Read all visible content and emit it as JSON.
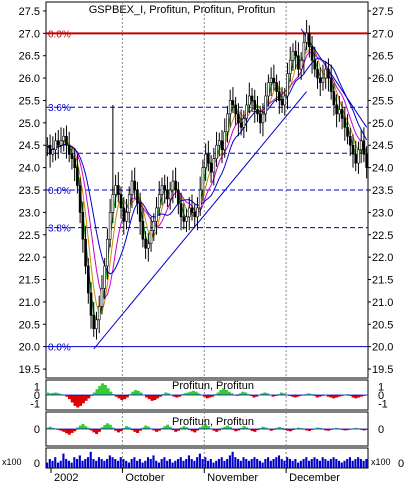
{
  "chart_data": [
    {
      "type": "candlestick",
      "title": "GSPBEX_I, Profitun, Profitun, Profitun",
      "y_ticks": [
        "27.5",
        "27.0",
        "26.5",
        "26.0",
        "25.5",
        "25.0",
        "24.5",
        "24.0",
        "23.5",
        "23.0",
        "22.5",
        "22.0",
        "21.5",
        "21.0",
        "20.5",
        "20.0",
        "19.5"
      ],
      "ylim": [
        19.3,
        27.7
      ],
      "x_ticks": [
        "2002",
        "October",
        "November",
        "December"
      ],
      "fib_levels": [
        {
          "label": "0.0%",
          "value": 27.0,
          "color": "#c00000"
        },
        {
          "label": "3.6%",
          "value": 25.35,
          "color": "#0000cc"
        },
        {
          "label": "",
          "value": 24.32,
          "color": "#0000cc"
        },
        {
          "label": "0.0%",
          "value": 23.5,
          "color": "#0000cc"
        },
        {
          "label": "3.8%",
          "value": 22.66,
          "color": "#0000cc"
        },
        {
          "label": "0.0%",
          "value": 20.0,
          "color": "#0000cc"
        }
      ],
      "close": [
        24.5,
        24.3,
        24.4,
        24.6,
        24.5,
        24.6,
        24.7,
        24.5,
        24.3,
        24.2,
        24.0,
        23.6,
        23.0,
        22.4,
        21.8,
        21.2,
        20.7,
        20.4,
        20.6,
        20.9,
        21.3,
        21.8,
        22.4,
        23.0,
        23.4,
        23.6,
        23.4,
        23.1,
        22.8,
        23.0,
        23.4,
        23.7,
        23.5,
        23.2,
        22.8,
        22.4,
        22.2,
        22.3,
        22.6,
        22.8,
        23.1,
        23.4,
        23.6,
        23.5,
        23.3,
        23.5,
        23.7,
        23.5,
        23.2,
        22.9,
        22.8,
        22.9,
        23.1,
        23.0,
        22.9,
        23.1,
        23.5,
        24.0,
        24.3,
        24.1,
        23.9,
        24.2,
        24.5,
        24.6,
        24.4,
        24.8,
        25.2,
        25.5,
        25.4,
        25.2,
        25.0,
        24.9,
        25.1,
        25.4,
        25.6,
        25.5,
        25.3,
        25.2,
        25.0,
        25.2,
        25.6,
        25.9,
        26.0,
        25.9,
        25.7,
        25.5,
        25.4,
        25.6,
        26.1,
        26.4,
        26.6,
        26.5,
        26.2,
        26.4,
        26.8,
        27.0,
        26.7,
        26.4,
        26.2,
        26.0,
        25.9,
        26.0,
        26.2,
        26.0,
        25.7,
        25.4,
        25.2,
        25.3,
        25.1,
        24.9,
        24.7,
        24.5,
        24.3,
        24.1,
        24.4,
        24.6,
        24.3,
        24.0
      ],
      "y_label_color": "#0000cc"
    },
    {
      "type": "histogram",
      "title": "Profitun, Profitun",
      "y_ticks": [
        "1",
        "0",
        "-1"
      ],
      "ylim": [
        -1.8,
        1.8
      ],
      "values": [
        0.3,
        0.2,
        0.25,
        0.3,
        0.2,
        0.1,
        0.0,
        -0.2,
        -0.5,
        -0.9,
        -1.3,
        -1.5,
        -1.3,
        -1.0,
        -0.7,
        -0.4,
        -0.1,
        0.3,
        0.7,
        1.1,
        1.4,
        1.2,
        0.8,
        0.4,
        0.1,
        -0.2,
        -0.4,
        -0.6,
        -0.5,
        -0.3,
        0.1,
        0.4,
        0.6,
        0.5,
        0.3,
        0.0,
        -0.3,
        -0.5,
        -0.7,
        -0.6,
        -0.4,
        -0.2,
        0.1,
        0.3,
        0.2,
        0.0,
        -0.2,
        -0.3,
        -0.2,
        0.1,
        0.2,
        0.3,
        0.4,
        0.5,
        0.4,
        0.2,
        0.0,
        -0.2,
        -0.4,
        -0.3,
        -0.2,
        0.1,
        0.3,
        0.6,
        0.8,
        0.6,
        0.4,
        0.2,
        0.0,
        -0.1,
        0.2,
        0.4,
        0.3,
        0.1,
        -0.1,
        -0.3,
        -0.2,
        0.0,
        0.2,
        0.3,
        0.2,
        0.0,
        -0.2,
        -0.1,
        0.1,
        0.3,
        0.2,
        0.0,
        -0.1,
        -0.2,
        -0.3,
        -0.2,
        -0.1,
        0.0,
        0.1,
        0.2,
        0.1,
        -0.1,
        -0.3,
        -0.2,
        -0.1,
        0.0,
        -0.2,
        -0.3,
        -0.4,
        -0.3,
        -0.2,
        -0.1,
        0.0,
        0.1,
        -0.1,
        -0.3,
        -0.4,
        -0.3,
        -0.2,
        -0.1,
        0.0
      ],
      "pos_color": "#33cc33",
      "neg_color": "#dd0000"
    },
    {
      "type": "histogram",
      "title": "Profitun, Profitun",
      "y_ticks": [
        "0"
      ],
      "ylim": [
        -0.6,
        0.6
      ],
      "values": [
        0.05,
        0.08,
        0.04,
        0.02,
        -0.03,
        -0.06,
        -0.1,
        -0.15,
        -0.2,
        -0.14,
        -0.08,
        0.05,
        0.12,
        0.18,
        0.1,
        0.04,
        -0.05,
        -0.12,
        -0.18,
        -0.1,
        0.06,
        0.14,
        0.2,
        0.15,
        0.05,
        -0.06,
        -0.12,
        -0.08,
        0.04,
        0.1,
        0.06,
        -0.04,
        -0.1,
        -0.14,
        -0.06,
        0.05,
        0.12,
        0.08,
        0.02,
        -0.05,
        -0.1,
        -0.06,
        0.04,
        0.1,
        0.15,
        0.08,
        -0.04,
        -0.1,
        -0.06,
        0.05,
        0.1,
        0.06,
        -0.03,
        -0.08,
        -0.12,
        -0.05,
        0.06,
        0.12,
        0.16,
        0.1,
        0.02,
        -0.06,
        -0.1,
        -0.05,
        0.04,
        0.08,
        0.12,
        0.07,
        -0.03,
        -0.08,
        -0.05,
        0.04,
        0.1,
        0.06,
        -0.02,
        -0.07,
        -0.1,
        -0.04,
        0.03,
        0.08,
        0.05,
        -0.02,
        -0.06,
        -0.03,
        0.04,
        0.07,
        0.04,
        -0.03,
        -0.06,
        -0.08,
        -0.04,
        0.02,
        0.05,
        0.03,
        -0.02,
        -0.05,
        -0.07,
        -0.03,
        0.02,
        0.05,
        0.04,
        -0.02,
        -0.05,
        -0.06,
        -0.03,
        0.02,
        0.04,
        0.02,
        -0.03,
        -0.05,
        -0.04,
        -0.02,
        0.02,
        0.04,
        0.02,
        -0.03,
        -0.05,
        -0.03
      ],
      "pos_color": "#33cc33",
      "neg_color": "#dd0000"
    },
    {
      "type": "bar",
      "title": "",
      "left_label": "x100",
      "right_label": "x100",
      "y_ticks": [
        "0"
      ],
      "values": [
        0.3,
        0.5,
        0.4,
        0.6,
        0.3,
        0.4,
        0.8,
        0.5,
        0.4,
        0.3,
        0.6,
        0.5,
        0.7,
        0.4,
        0.5,
        0.6,
        0.9,
        0.5,
        0.4,
        0.6,
        0.5,
        0.4,
        0.5,
        0.7,
        0.6,
        0.5,
        0.4,
        0.6,
        0.5,
        0.4,
        0.3,
        0.5,
        0.6,
        0.4,
        0.5,
        0.3,
        0.4,
        0.6,
        0.5,
        0.7,
        0.4,
        0.3,
        0.5,
        0.6,
        0.4,
        0.5,
        0.3,
        0.4,
        0.5,
        0.6,
        0.4,
        0.5,
        0.7,
        0.5,
        0.4,
        0.6,
        0.8,
        0.5,
        0.6,
        0.4,
        0.5,
        0.3,
        0.4,
        0.5,
        0.6,
        0.4,
        0.5,
        0.7,
        0.9,
        0.6,
        0.5,
        0.4,
        0.6,
        0.5,
        0.4,
        0.5,
        0.6,
        0.5,
        0.4,
        0.3,
        0.5,
        0.6,
        0.4,
        0.5,
        0.6,
        0.7,
        0.5,
        0.4,
        0.6,
        0.5,
        0.4,
        0.5,
        0.3,
        0.4,
        0.5,
        0.6,
        0.4,
        0.5,
        0.6,
        0.5,
        0.4,
        0.6,
        0.5,
        0.4,
        0.5,
        0.6,
        0.5,
        0.4,
        0.3,
        0.4,
        0.5,
        0.6,
        0.4,
        0.5,
        0.6,
        0.5,
        0.4,
        0.5
      ],
      "bar_color": "#0000cc"
    }
  ]
}
